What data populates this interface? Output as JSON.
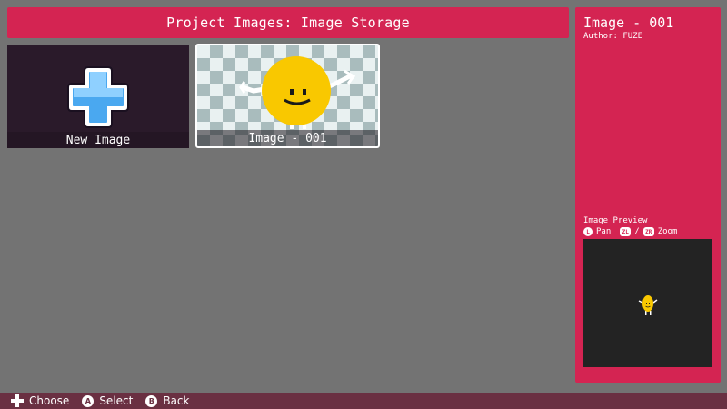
{
  "header": {
    "title": "Project Images: Image Storage"
  },
  "tiles": [
    {
      "label": "New Image",
      "icon": "plus-icon"
    },
    {
      "label": "Image - 001",
      "icon": "smiley-sprite",
      "selected": true
    }
  ],
  "details": {
    "title": "Image - 001",
    "author": "Author: FUZE",
    "preview_heading": "Image Preview",
    "controls": {
      "pan_button": "L",
      "pan_label": "Pan",
      "zoom_button_1": "ZL",
      "separator": "/",
      "zoom_button_2": "ZR",
      "zoom_label": "Zoom"
    }
  },
  "footer": {
    "choose_label": "Choose",
    "select_button": "A",
    "select_label": "Select",
    "back_button": "B",
    "back_label": "Back"
  },
  "colors": {
    "accent": "#d42452",
    "background": "#737373",
    "footer": "#6a3042",
    "preview_bg": "#232323"
  }
}
